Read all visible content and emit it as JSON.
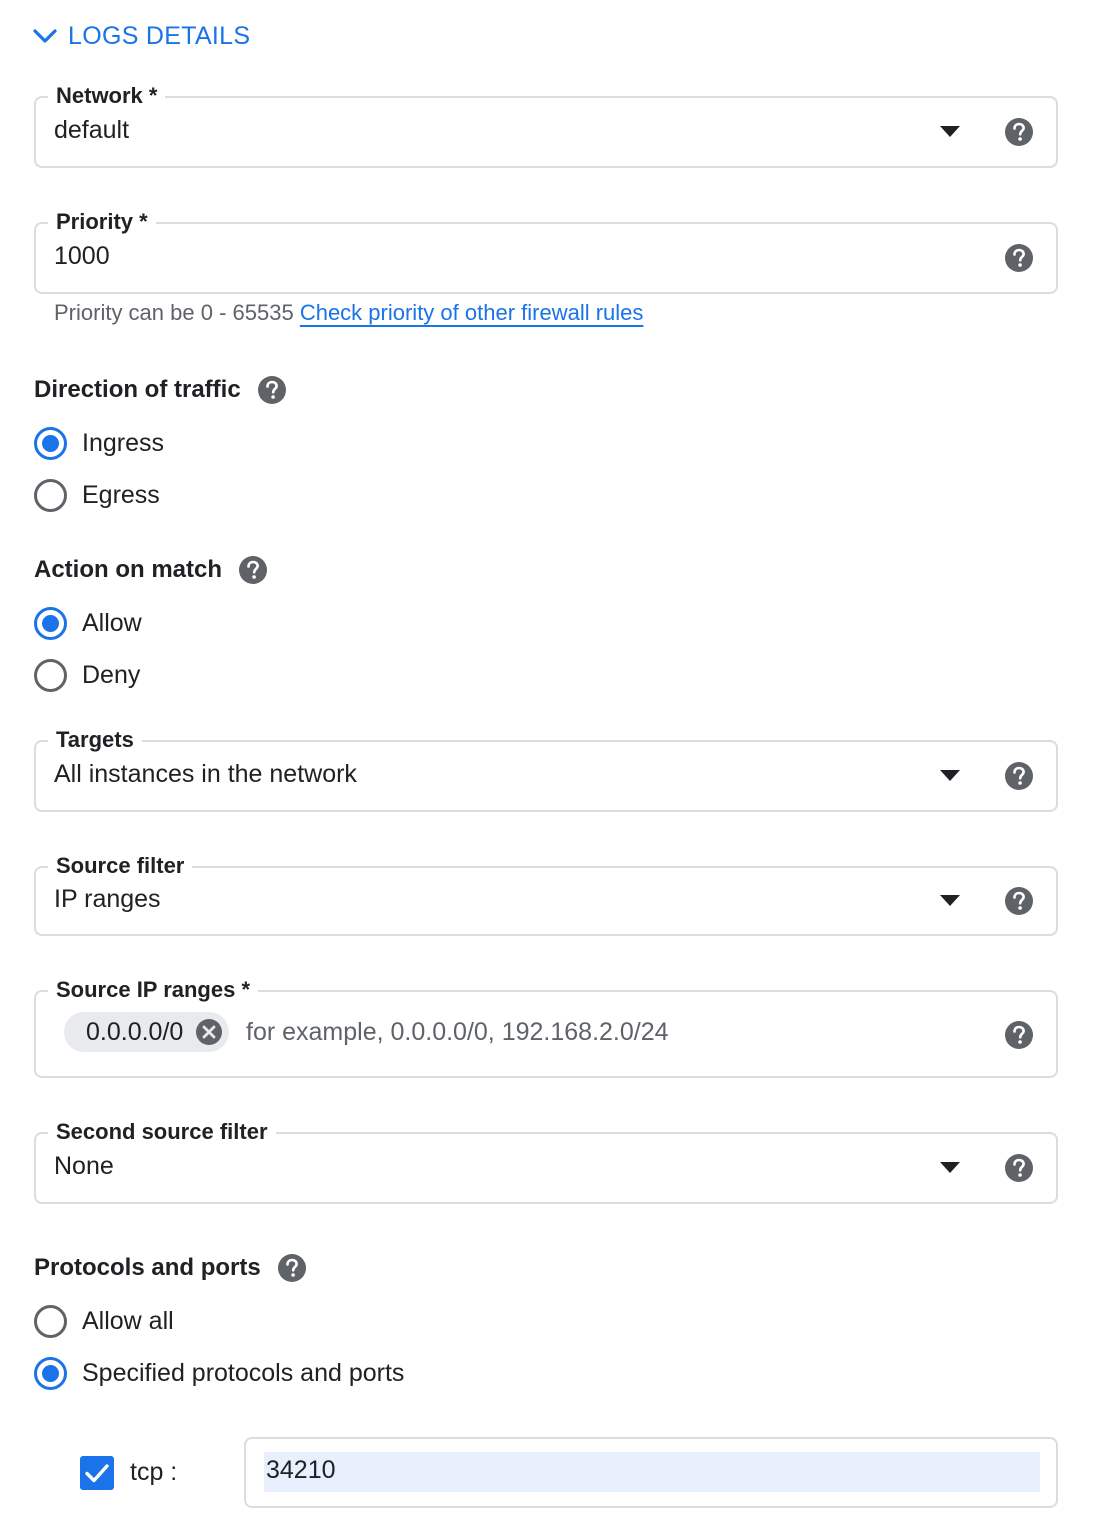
{
  "header": {
    "label": "LOGS DETAILS",
    "icon": "chevron-down-icon"
  },
  "network": {
    "label": "Network *",
    "value": "default"
  },
  "priority": {
    "label": "Priority *",
    "value": "1000",
    "hint": "Priority can be 0 - 65535",
    "link": "Check priority of other firewall rules"
  },
  "direction": {
    "title": "Direction of traffic",
    "options": [
      {
        "label": "Ingress",
        "selected": true
      },
      {
        "label": "Egress",
        "selected": false
      }
    ]
  },
  "action": {
    "title": "Action on match",
    "options": [
      {
        "label": "Allow",
        "selected": true
      },
      {
        "label": "Deny",
        "selected": false
      }
    ]
  },
  "targets": {
    "label": "Targets",
    "value": "All instances in the network"
  },
  "source_filter": {
    "label": "Source filter",
    "value": "IP ranges"
  },
  "source_ip_ranges": {
    "label": "Source IP ranges *",
    "chips": [
      "0.0.0.0/0"
    ],
    "placeholder": "for example, 0.0.0.0/0, 192.168.2.0/24"
  },
  "second_source_filter": {
    "label": "Second source filter",
    "value": "None"
  },
  "protocols": {
    "title": "Protocols and ports",
    "options": [
      {
        "label": "Allow all",
        "selected": false
      },
      {
        "label": "Specified protocols and ports",
        "selected": true
      }
    ],
    "tcp": {
      "label": "tcp :",
      "checked": true,
      "value": "34210"
    }
  },
  "colors": {
    "accent": "#1a73e8",
    "border": "#dadce0",
    "icon": "#5f6368"
  }
}
